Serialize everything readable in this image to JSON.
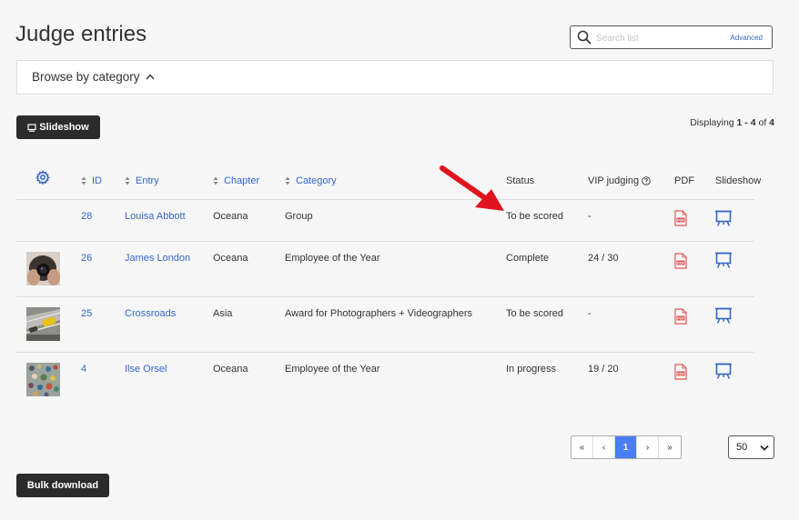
{
  "page": {
    "title": "Judge entries"
  },
  "search": {
    "placeholder": "Search list",
    "advanced_label": "Advanced"
  },
  "browse": {
    "label": "Browse by category"
  },
  "toolbar": {
    "slideshow_label": "Slideshow",
    "displaying_prefix": "Displaying ",
    "displaying_range": "1 - 4",
    "displaying_of": " of ",
    "displaying_total": "4"
  },
  "table": {
    "columns": [
      "ID",
      "Entry",
      "Chapter",
      "Category",
      "Status",
      "VIP judging",
      "PDF",
      "Slideshow"
    ],
    "rows": [
      {
        "id": "28",
        "entry": "Louisa Abbott",
        "chapter": "Oceana",
        "category": "Group",
        "status": "To be scored",
        "vip": "-",
        "thumb": "none"
      },
      {
        "id": "26",
        "entry": "James London",
        "chapter": "Oceana",
        "category": "Employee of the Year",
        "status": "Complete",
        "vip": "24 / 30",
        "thumb": "camera-photo"
      },
      {
        "id": "25",
        "entry": "Crossroads",
        "chapter": "Asia",
        "category": "Award for Photographers + Videographers",
        "status": "To be scored",
        "vip": "-",
        "thumb": "street-photo"
      },
      {
        "id": "4",
        "entry": "Ilse Orsel",
        "chapter": "Oceana",
        "category": "Employee of the Year",
        "status": "In progress",
        "vip": "19 / 20",
        "thumb": "crowd-photo"
      }
    ]
  },
  "pagination": {
    "first": "«",
    "prev": "‹",
    "current": "1",
    "next": "›",
    "last": "»"
  },
  "per_page": {
    "selected": "50"
  },
  "footer": {
    "bulk_download_label": "Bulk download"
  },
  "colors": {
    "link": "#3366cc",
    "pdf_red": "#d9534f",
    "active_page": "#4a7df6",
    "arrow_red": "#e0141e",
    "button_dark": "#2b2b2b"
  },
  "icons": [
    "search-icon",
    "chevron-up-icon",
    "monitor-icon",
    "gear-icon",
    "sort-icon",
    "help-circle-icon",
    "pdf-icon",
    "slideshow-easel-icon",
    "chevron-down-icon"
  ]
}
